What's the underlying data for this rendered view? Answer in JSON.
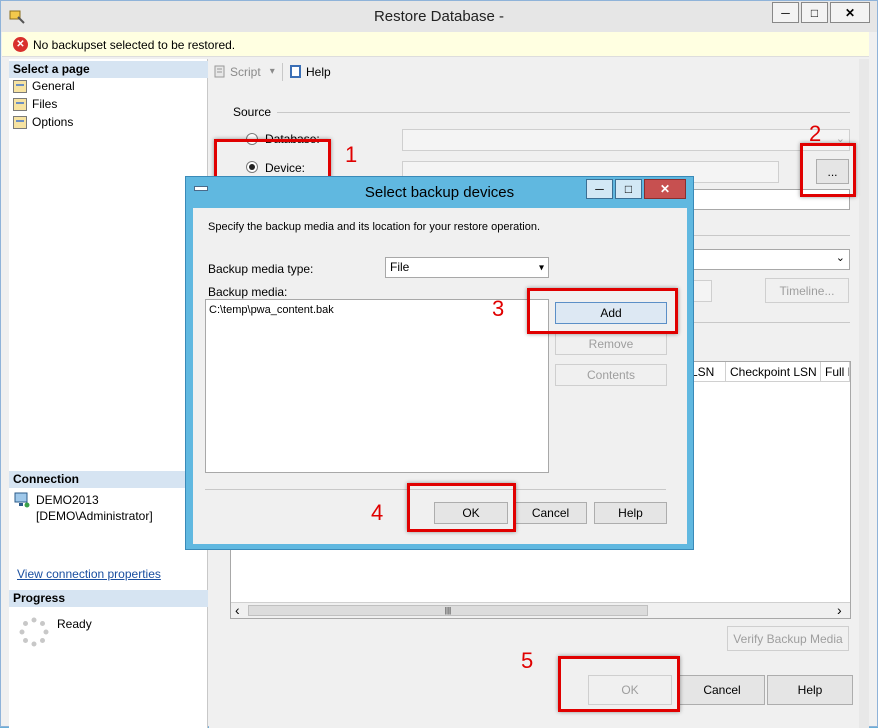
{
  "window": {
    "title": "Restore Database -",
    "minimize": "─",
    "maximize": "□",
    "close": "✕"
  },
  "error_bar": {
    "icon": "✕",
    "message": "No backupset selected to be restored."
  },
  "left_pane": {
    "select_page_header": "Select a page",
    "pages": [
      {
        "label": "General"
      },
      {
        "label": "Files"
      },
      {
        "label": "Options"
      }
    ],
    "connection_header": "Connection",
    "server": "DEMO2013",
    "user": "[DEMO\\Administrator]",
    "view_connection_link": "View connection properties",
    "progress_header": "Progress",
    "progress_status": "Ready"
  },
  "toolbar": {
    "script_label": "Script",
    "script_arrow": "▾",
    "help_label": "Help"
  },
  "source": {
    "group_label": "Source",
    "database_label": "Database:",
    "device_label": "Device:",
    "browse_label": "...",
    "database_arrow": "⌄"
  },
  "main": {
    "timeline_label": "Timeline...",
    "grid_columns": [
      "LSN",
      "Checkpoint LSN",
      "Full LS"
    ],
    "verify_label": "Verify Backup Media",
    "ok_label": "OK",
    "cancel_label": "Cancel",
    "help_label": "Help",
    "scroll_left": "‹",
    "scroll_right": "›",
    "scroll_thumb": "|||"
  },
  "dialog": {
    "title": "Select backup devices",
    "minimize": "─",
    "maximize": "□",
    "close": "✕",
    "instruction": "Specify the backup media and its location for your restore operation.",
    "media_type_label": "Backup media type:",
    "media_type_value": "File",
    "select_arrow": "▾",
    "media_label": "Backup media:",
    "media_items": [
      "C:\\temp\\pwa_content.bak"
    ],
    "add_label": "Add",
    "remove_label": "Remove",
    "contents_label": "Contents",
    "ok_label": "OK",
    "cancel_label": "Cancel",
    "help_label": "Help"
  },
  "annotations": {
    "step1": "1",
    "step2": "2",
    "step3": "3",
    "step4": "4",
    "step5": "5"
  },
  "colors": {
    "annotation_red": "#e00000",
    "dialog_frame": "#60b8e0",
    "dialog_close": "#c75050",
    "error_bg": "#ffffe1"
  }
}
